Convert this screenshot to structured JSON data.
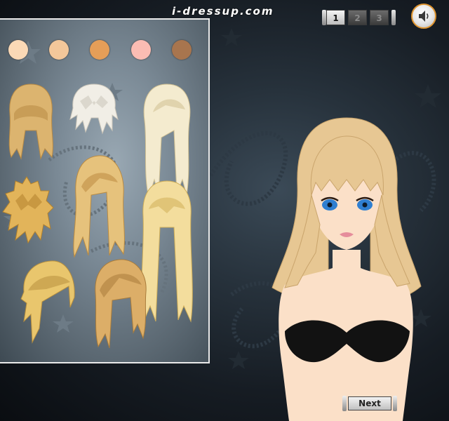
{
  "brand": {
    "text": "i-dressup.com"
  },
  "pager": {
    "pages": [
      "1",
      "2",
      "3"
    ],
    "active_page": "1"
  },
  "sound": {
    "icon": "speaker-icon"
  },
  "skin_tones": [
    {
      "name": "skin-tone-fair",
      "color": "#fbd9b6"
    },
    {
      "name": "skin-tone-light",
      "color": "#f3c79a"
    },
    {
      "name": "skin-tone-tan",
      "color": "#e59e58"
    },
    {
      "name": "skin-tone-pink",
      "color": "#fbbcb3"
    },
    {
      "name": "skin-tone-brown",
      "color": "#a8754e"
    }
  ],
  "hairstyles": [
    {
      "name": "hairstyle-blonde-bangs-shoulder",
      "color": "#dcb46f",
      "shade": "#b88a44"
    },
    {
      "name": "hairstyle-platinum-spiky-short",
      "color": "#f1eee6",
      "shade": "#c9c4b8"
    },
    {
      "name": "hairstyle-platinum-long-side-part",
      "color": "#f4ebcf",
      "shade": "#cfbf92"
    },
    {
      "name": "hairstyle-blonde-messy-bob",
      "color": "#e2b45a",
      "shade": "#b3822d"
    },
    {
      "name": "hairstyle-blonde-long-straight",
      "color": "#e6c27c",
      "shade": "#bb8b40"
    },
    {
      "name": "hairstyle-blonde-extra-long",
      "color": "#f3dd9d",
      "shade": "#cfae58"
    },
    {
      "name": "hairstyle-blonde-short-side-swept",
      "color": "#e9c66d",
      "shade": "#b8903e"
    },
    {
      "name": "hairstyle-blonde-bob-with-fringe",
      "color": "#dcae68",
      "shade": "#a97c3b"
    }
  ],
  "model": {
    "hair_color": "#e7c793",
    "skin_color": "#fbe0c8",
    "top_color": "#121212",
    "eye_color": "#2f7fd1"
  },
  "buttons": {
    "next_label": "Next"
  }
}
